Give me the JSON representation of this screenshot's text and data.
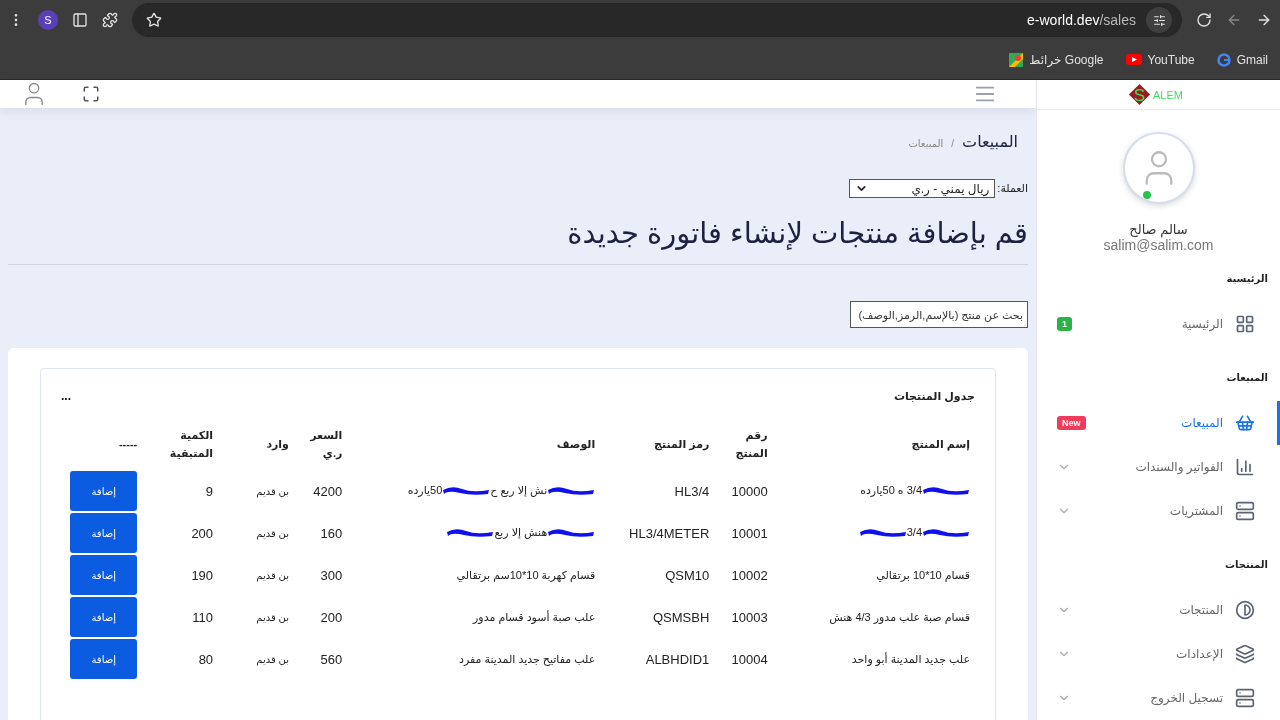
{
  "browser": {
    "profile_initial": "S",
    "url_host": "e-world.dev",
    "url_path": "/sales",
    "bookmarks": [
      {
        "label": "Gmail",
        "kind": "gmail"
      },
      {
        "label": "YouTube",
        "kind": "youtube"
      },
      {
        "label": "خرائط Google",
        "kind": "maps"
      }
    ]
  },
  "sidebar": {
    "logo": {
      "letter": "S",
      "text": "ALEM"
    },
    "user": {
      "name": "سالم صالح",
      "email": "salim@salim.com",
      "online": true
    },
    "sections": [
      {
        "title": "الرئيسية",
        "items": [
          {
            "label": "الرئيسية",
            "kind": "grid",
            "selected": false,
            "expandable": false,
            "badge": {
              "text": "1",
              "color": "#28b446"
            }
          }
        ]
      },
      {
        "title": "المبيعات",
        "items": [
          {
            "label": "المبيعات",
            "kind": "basket",
            "selected": true,
            "expandable": false,
            "badge": {
              "text": "New",
              "color": "#ef3b5c"
            }
          },
          {
            "label": "الفواتير والسندات",
            "kind": "chart",
            "selected": false,
            "expandable": true
          },
          {
            "label": "المشتريات",
            "kind": "server",
            "selected": false,
            "expandable": true
          }
        ]
      },
      {
        "title": "المنتجات",
        "items": [
          {
            "label": "المنتجات",
            "kind": "contrast",
            "selected": false,
            "expandable": true
          },
          {
            "label": "الإعدادات",
            "kind": "layers",
            "selected": false,
            "expandable": true
          },
          {
            "label": "تسجيل الخروج",
            "kind": "server",
            "selected": false,
            "expandable": true
          }
        ]
      }
    ]
  },
  "page": {
    "title": "المبيعات",
    "breadcrumb_separator": "/",
    "breadcrumb": "المبيعات",
    "currency_label": "العملة:",
    "currency_value": "ريال يمني - ر.ي",
    "heading": "قم بإضافة منتجات لإنشاء فاتورة جديدة",
    "search": {
      "placeholder": "بحث عن منتج (بالإسم,الرمز,الوصف)"
    }
  },
  "table": {
    "title": "جدول المنتجات",
    "menu": "...",
    "columns": [
      "إسم المنتج",
      "رقم المنتج",
      "رمز المنتج",
      "الوصف",
      "السعر ر.ي",
      "وارد",
      "الكمية المتبقية",
      "-----"
    ],
    "rows": [
      {
        "name": [
          {
            "kind": "redaction"
          },
          {
            "kind": "text",
            "text": "3/4 ه 50يارده"
          }
        ],
        "number": "10000",
        "code": "HL3/4",
        "description": [
          {
            "kind": "redaction"
          },
          {
            "kind": "text",
            "text": "نش إلا ربع ح"
          },
          {
            "kind": "redaction"
          },
          {
            "kind": "text",
            "text": "50يارده"
          }
        ],
        "price": "4200",
        "incoming": "بن قديم",
        "quantity": "9",
        "action": "إضافة"
      },
      {
        "name": [
          {
            "kind": "redaction"
          },
          {
            "kind": "text",
            "text": "3/4"
          },
          {
            "kind": "redaction"
          }
        ],
        "number": "10001",
        "code": "HL3/4METER",
        "description": [
          {
            "kind": "redaction"
          },
          {
            "kind": "text",
            "text": "هنش إلا ربع"
          },
          {
            "kind": "redaction"
          }
        ],
        "price": "160",
        "incoming": "بن قديم",
        "quantity": "200",
        "action": "إضافة"
      },
      {
        "name": [
          {
            "kind": "text",
            "text": "قسام 10*10 برتقالي"
          }
        ],
        "number": "10002",
        "code": "QSM10",
        "description": [
          {
            "kind": "text",
            "text": "قسام كهربة 10*10سم برتقالي"
          }
        ],
        "price": "300",
        "incoming": "بن قديم",
        "quantity": "190",
        "action": "إضافة"
      },
      {
        "name": [
          {
            "kind": "text",
            "text": "قسام صبة علب مدور 4/3 هنش"
          }
        ],
        "number": "10003",
        "code": "QSMSBH",
        "description": [
          {
            "kind": "text",
            "text": "علب صبة أسود قسام مدور"
          }
        ],
        "price": "200",
        "incoming": "بن قديم",
        "quantity": "110",
        "action": "إضافة"
      },
      {
        "name": [
          {
            "kind": "text",
            "text": "علب جديد المدينة أبو واحد"
          }
        ],
        "number": "10004",
        "code": "ALBHDID1",
        "description": [
          {
            "kind": "text",
            "text": "علب مفاتيح جديد المدينة مفرد"
          }
        ],
        "price": "560",
        "incoming": "بن قديم",
        "quantity": "80",
        "action": "إضافة"
      }
    ]
  }
}
